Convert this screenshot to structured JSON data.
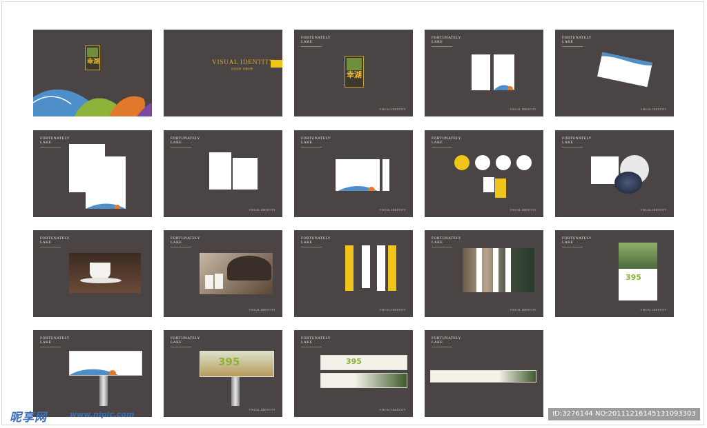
{
  "brand": {
    "title_line": "FORTUNATELY\nLAKE",
    "footer": "VISUAL IDENTITY",
    "cover_title": "VISUAL IDENTITY",
    "cover_subtitle": "标志应用 · 形象识别",
    "logo_chars": "幸湖",
    "billboard_number": "395"
  },
  "colors": {
    "panel": "#4a4444",
    "accent_yellow": "#f0c419",
    "wave_blue": "#4f8fc9",
    "wave_orange": "#e07a2a",
    "wave_green": "#8db33a",
    "wave_purple": "#7b4a9e"
  },
  "watermark": {
    "site_name": "昵享网",
    "url": "www.nipic.com",
    "id_text": "ID:3276144 NO:20111216145131093303"
  }
}
